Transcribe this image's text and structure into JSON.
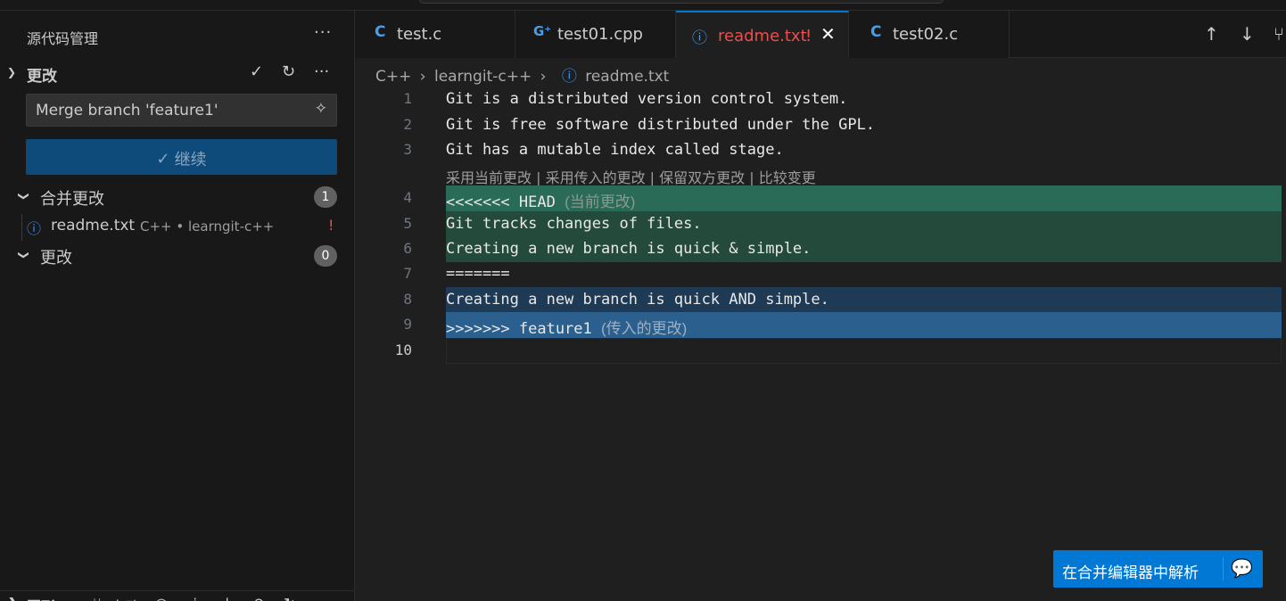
{
  "sidebar": {
    "title": "源代码管理",
    "more": "···",
    "changes_section": {
      "label": "更改",
      "icons": [
        "check-icon",
        "refresh-icon",
        "more-icon"
      ]
    },
    "commit_input": {
      "value": "Merge branch 'feature1'"
    },
    "continue_button": {
      "label": "继续"
    },
    "merge_changes": {
      "label": "合并更改",
      "count": "1"
    },
    "file": {
      "name": "readme.txt",
      "description": "C++ • learngit-c++",
      "status": "!"
    },
    "changes": {
      "label": "更改",
      "count": "0"
    },
    "bottom": {
      "label": "图形",
      "auto_label": "自动"
    }
  },
  "tabs": [
    {
      "icon": "C",
      "name": "test.c",
      "active": false,
      "icon_name": "c-file-icon"
    },
    {
      "icon": "G",
      "name": "test01.cpp",
      "active": false,
      "icon_name": "cpp-file-icon"
    },
    {
      "icon": "ⓘ",
      "name": "readme.txt",
      "status": "!",
      "active": true,
      "icon_name": "info-icon"
    },
    {
      "icon": "C",
      "name": "test02.c",
      "active": false,
      "icon_name": "c-file-icon"
    }
  ],
  "breadcrumb": [
    "C++",
    "learngit-c++",
    "readme.txt"
  ],
  "editor": {
    "codelens": "采用当前更改 | 采用传入的更改 | 保留双方更改 | 比较变更",
    "lines": [
      {
        "n": "1",
        "text": "Git is a distributed version control system."
      },
      {
        "n": "2",
        "text": "Git is free software distributed under the GPL."
      },
      {
        "n": "3",
        "text": "Git has a mutable index called stage."
      },
      {
        "n": "4",
        "text": "<<<<<<< HEAD",
        "hint": "(当前更改)"
      },
      {
        "n": "5",
        "text": "Git tracks changes of files."
      },
      {
        "n": "6",
        "text": "Creating a new branch is quick & simple."
      },
      {
        "n": "7",
        "text": "======="
      },
      {
        "n": "8",
        "text": "Creating a new branch is quick AND simple."
      },
      {
        "n": "9",
        "text": ">>>>>>> feature1",
        "hint": "(传入的更改)"
      },
      {
        "n": "10",
        "text": ""
      }
    ]
  },
  "resolve_button": {
    "label": "在合并编辑器中解析"
  },
  "colors": {
    "accent": "#0078d4",
    "current_header": "#2a6b58",
    "current_body": "#234a3b",
    "incoming_body": "#1f3a55",
    "incoming_header": "#2b5f8e",
    "error": "#f14c4c"
  }
}
